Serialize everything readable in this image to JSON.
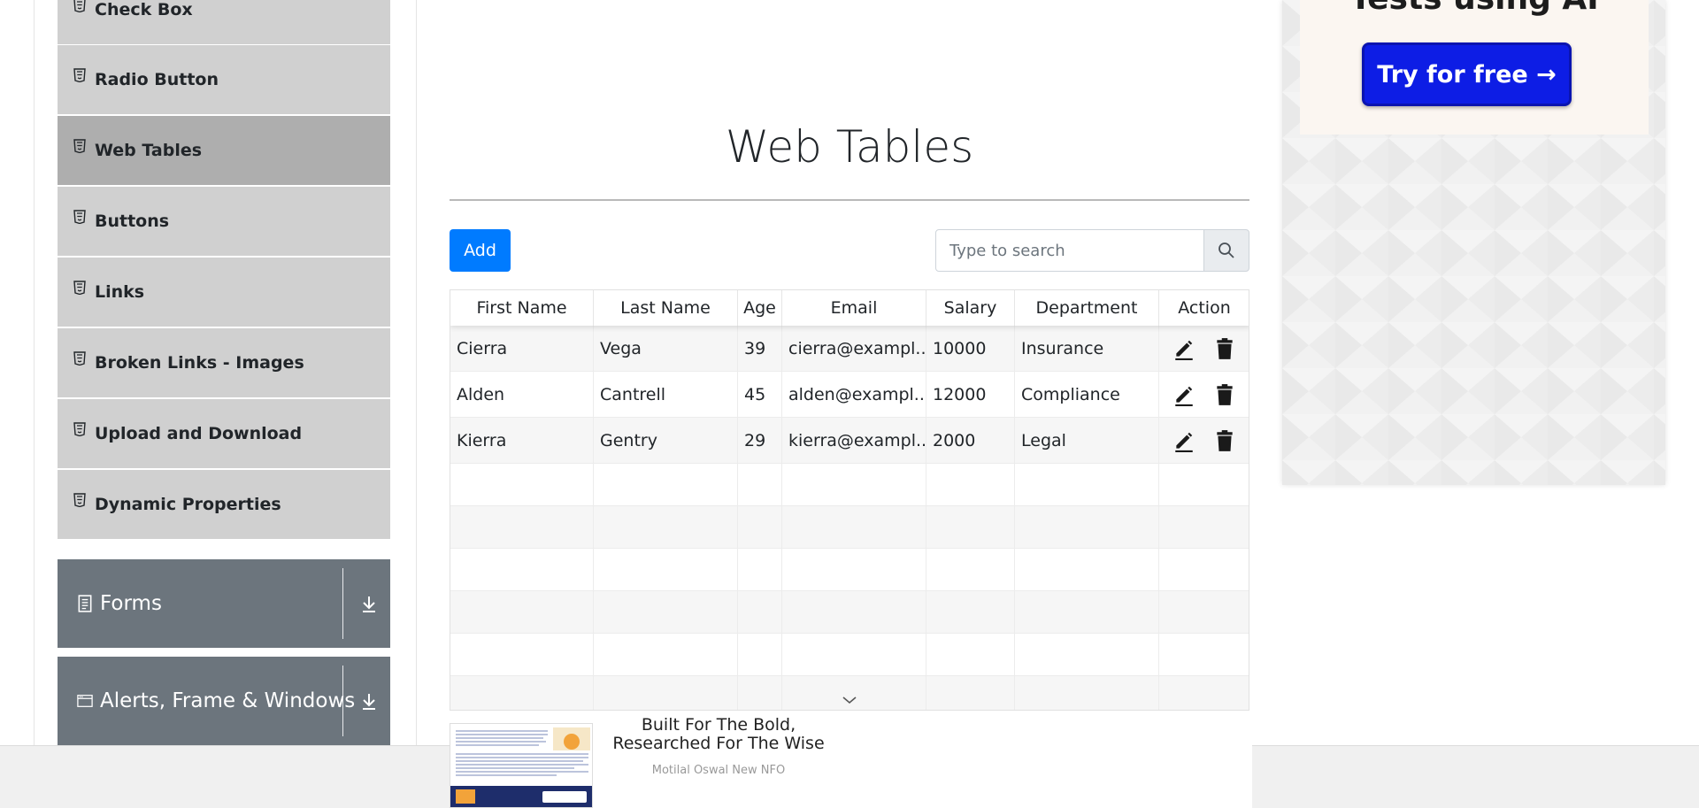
{
  "sidebar": {
    "elements_items": [
      {
        "label": "Check Box",
        "active": false
      },
      {
        "label": "Radio Button",
        "active": false
      },
      {
        "label": "Web Tables",
        "active": true
      },
      {
        "label": "Buttons",
        "active": false
      },
      {
        "label": "Links",
        "active": false
      },
      {
        "label": "Broken Links - Images",
        "active": false
      },
      {
        "label": "Upload and Download",
        "active": false
      },
      {
        "label": "Dynamic Properties",
        "active": false
      }
    ],
    "groups": [
      {
        "label": "Forms",
        "icon": "document-icon"
      },
      {
        "label": "Alerts, Frame & Windows",
        "icon": "window-icon"
      }
    ]
  },
  "main": {
    "title": "Web Tables",
    "add_label": "Add",
    "search_placeholder": "Type to search"
  },
  "table": {
    "columns": [
      "First Name",
      "Last Name",
      "Age",
      "Email",
      "Salary",
      "Department",
      "Action"
    ],
    "rows": [
      {
        "first": "Cierra",
        "last": "Vega",
        "age": "39",
        "email": "cierra@exampl...",
        "salary": "10000",
        "department": "Insurance"
      },
      {
        "first": "Alden",
        "last": "Cantrell",
        "age": "45",
        "email": "alden@exampl...",
        "salary": "12000",
        "department": "Compliance"
      },
      {
        "first": "Kierra",
        "last": "Gentry",
        "age": "29",
        "email": "kierra@exampl...",
        "salary": "2000",
        "department": "Legal"
      }
    ],
    "empty_rows": 6
  },
  "right_ad": {
    "heading": "Tests using AI",
    "button_label": "Try for free →"
  },
  "bottom_ad": {
    "title": "Built For The Bold, Researched For The Wise",
    "sponsor": "Motilal Oswal New NFO"
  },
  "colors": {
    "primary": "#007bff",
    "group_header": "#6c757d",
    "menu_item": "#d0d0d0",
    "menu_item_active": "#aeaeae",
    "ad_button": "#0d1de5"
  }
}
